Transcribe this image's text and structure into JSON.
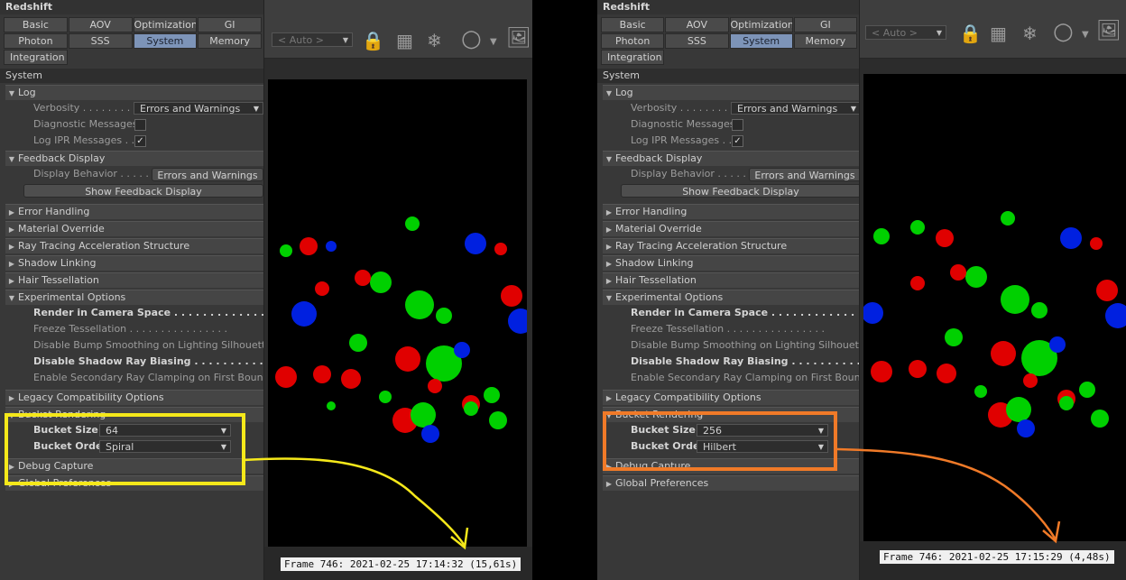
{
  "left": {
    "panel_title": "Redshift",
    "tabs": [
      "Basic",
      "AOV",
      "Optimization",
      "GI",
      "Photon",
      "SSS",
      "System",
      "Memory",
      "Integration"
    ],
    "section": "System",
    "groups": {
      "log": "Log",
      "verbosity_label": "Verbosity . . . . . . . . .",
      "verbosity_value": "Errors and Warnings",
      "diagnostic": "Diagnostic Messages",
      "log_ipr": "Log IPR Messages . .",
      "feedback": "Feedback Display",
      "display_behavior": "Display Behavior . . . . . . .",
      "display_behavior_value": "Errors and Warnings",
      "show_feedback": "Show Feedback Display",
      "error_handling": "Error Handling",
      "material_override": "Material Override",
      "ray_tracing": "Ray Tracing Acceleration Structure",
      "shadow_linking": "Shadow Linking",
      "hair_tess": "Hair Tessellation",
      "experimental": "Experimental Options",
      "render_camera": "Render in Camera Space . . . . . . . . . . . . . .",
      "freeze_tess": "Freeze Tessellation . . . . . . . . . . . . . . . .",
      "disable_bump": "Disable Bump Smoothing on Lighting Silhouettes",
      "disable_shadow": "Disable Shadow Ray Biasing . . . . . . . . . . .",
      "enable_secondary": "Enable Secondary Ray Clamping on First Bounce",
      "legacy": "Legacy Compatibility Options",
      "bucket": "Bucket Rendering",
      "bucket_size_label": "Bucket Size",
      "bucket_size_value": "64",
      "bucket_order_label": "Bucket Order",
      "bucket_order_value": "Spiral",
      "debug": "Debug Capture",
      "global_prefs": "Global Preferences"
    },
    "auto_label": "< Auto >",
    "frame_label": "Frame  746:  2021-02-25  17:14:32  (15,61s)"
  },
  "right": {
    "panel_title": "Redshift",
    "tabs": [
      "Basic",
      "AOV",
      "Optimization",
      "GI",
      "Photon",
      "SSS",
      "System",
      "Memory",
      "Integration"
    ],
    "section": "System",
    "groups": {
      "log": "Log",
      "verbosity_label": "Verbosity . . . . . . . . .",
      "verbosity_value": "Errors and Warnings",
      "diagnostic": "Diagnostic Messages",
      "log_ipr": "Log IPR Messages . .",
      "feedback": "Feedback Display",
      "display_behavior": "Display Behavior . . . . . . .",
      "display_behavior_value": "Errors and Warnings",
      "show_feedback": "Show Feedback Display",
      "error_handling": "Error Handling",
      "material_override": "Material Override",
      "ray_tracing": "Ray Tracing Acceleration Structure",
      "shadow_linking": "Shadow Linking",
      "hair_tess": "Hair Tessellation",
      "experimental": "Experimental Options",
      "render_camera": "Render in Camera Space . . . . . . . . . . . . . .",
      "freeze_tess": "Freeze Tessellation . . . . . . . . . . . . . . . .",
      "disable_bump": "Disable Bump Smoothing on Lighting Silhouettes",
      "disable_shadow": "Disable Shadow Ray Biasing . . . . . . . . . . .",
      "enable_secondary": "Enable Secondary Ray Clamping on First Bounce",
      "legacy": "Legacy Compatibility Options",
      "bucket": "Bucket Rendering",
      "bucket_size_label": "Bucket Size",
      "bucket_size_value": "256",
      "bucket_order_label": "Bucket Order",
      "bucket_order_value": "Hilbert",
      "debug": "Debug Capture",
      "global_prefs": "Global Preferences"
    },
    "auto_label": "< Auto >",
    "frame_label": "Frame  746:  2021-02-25  17:15:29  (4,48s)"
  },
  "colors": {
    "highlight_left": "#f5e81a",
    "highlight_right": "#f07a28",
    "active_tab": "#7d94b8"
  }
}
